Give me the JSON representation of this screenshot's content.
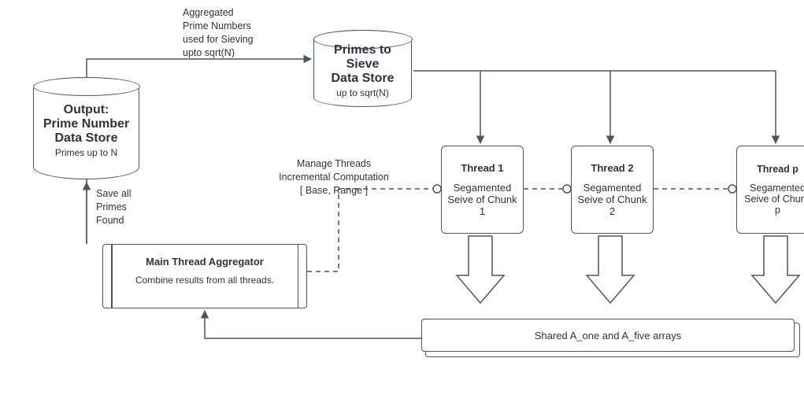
{
  "diagram": {
    "output_store": {
      "title_line1": "Output:",
      "title_line2": "Prime Number",
      "title_line3": "Data Store",
      "subtitle": "Primes up to N"
    },
    "sieve_store": {
      "title_line1": "Primes to Sieve",
      "title_line2": "Data Store",
      "subtitle": "up to sqrt(N)"
    },
    "aggregated_label": {
      "line1": "Aggregated",
      "line2": "Prime Numbers",
      "line3": "used for Sieving",
      "line4": "upto sqrt(N)"
    },
    "save_label": {
      "line1": "Save all",
      "line2": "Primes",
      "line3": "Found"
    },
    "manage_label": {
      "line1": "Manage Threads",
      "line2": "Incremental Computation",
      "line3": "[ Base, Range ]"
    },
    "aggregator": {
      "title": "Main Thread Aggregator",
      "subtitle": "Combine results from all threads."
    },
    "threads": [
      {
        "title": "Thread 1",
        "line1": "Segamented",
        "line2": "Seive of Chunk 1"
      },
      {
        "title": "Thread 2",
        "line1": "Segamented",
        "line2": "Seive of Chunk 2"
      },
      {
        "title": "Thread p",
        "line1": "Segamented",
        "line2": "Seive of Chunk p"
      }
    ],
    "shared_arrays": "Shared A_one and A_five arrays"
  }
}
